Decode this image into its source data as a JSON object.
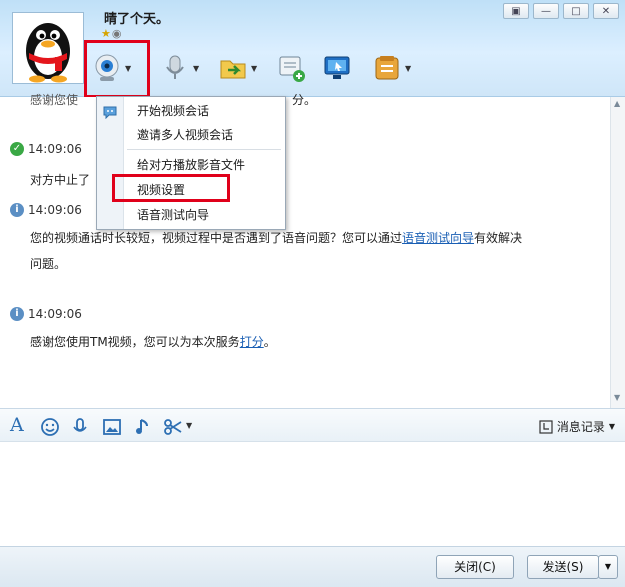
{
  "header": {
    "buddy_name": "晴了个天。",
    "window_buttons": [
      "▣",
      "—",
      "□",
      "✕"
    ]
  },
  "menu": {
    "items": [
      "开始视频会话",
      "邀请多人视频会话",
      "给对方播放影音文件",
      "视频设置",
      "语音测试向导"
    ]
  },
  "chat": {
    "partial_top_text": "感谢您使",
    "partial_top_link_fragment": "分。",
    "messages": [
      {
        "time": "14:09:06",
        "status": "success",
        "text": "对方中止了"
      },
      {
        "time": "14:09:06",
        "status": "info",
        "text_before_link": "您的视频通话时长较短，视频过程中是否遇到了语音问题？您可以通过",
        "link": "语音测试向导",
        "text_after_link": "有效解决",
        "text_line2": "问题。"
      },
      {
        "time": "14:09:06",
        "status": "info",
        "text_before_link": "感谢您使用TM视频，您可以为本次服务",
        "link": "打分",
        "text_after_link": "。"
      }
    ]
  },
  "input_toolbar": {
    "history_label": "消息记录"
  },
  "buttons": {
    "close_label": "关闭(C)",
    "send_label": "发送(S)"
  },
  "colors": {
    "highlight_red": "#e0001a",
    "link_blue": "#1a5fb4",
    "header_blue": "#cfe6f8"
  }
}
